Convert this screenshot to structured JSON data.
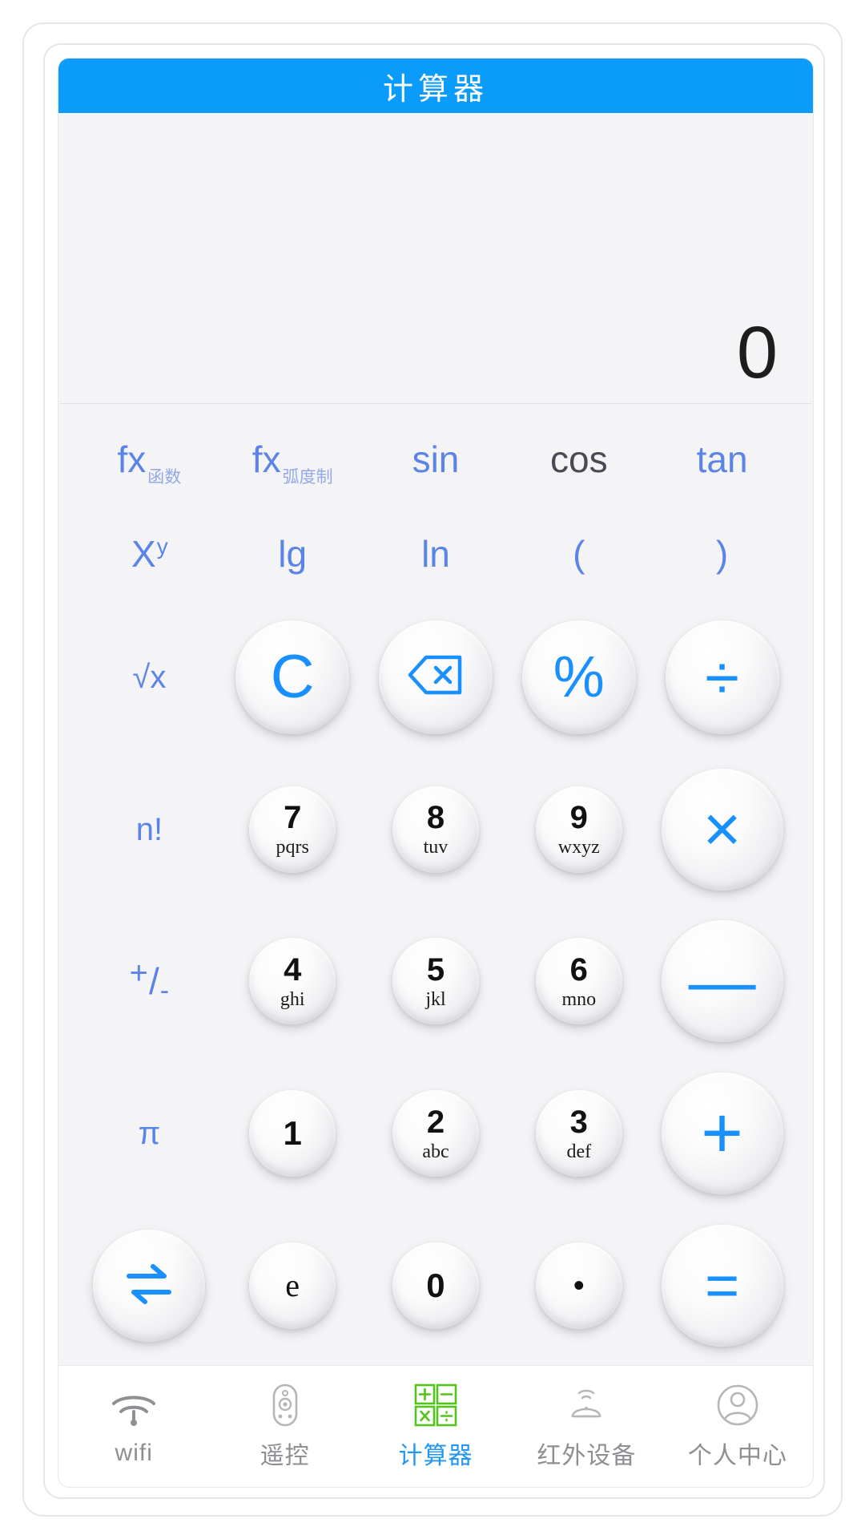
{
  "header": {
    "title": "计算器"
  },
  "display": {
    "expression": "",
    "value": "0"
  },
  "keypad": {
    "rows": [
      {
        "type": "text",
        "keys": [
          {
            "name": "key-function",
            "main": "fx",
            "sub": "函数",
            "style": "blue"
          },
          {
            "name": "key-radian",
            "main": "fx",
            "sub": "弧度制",
            "style": "blue"
          },
          {
            "name": "key-sin",
            "main": "sin",
            "sub": "",
            "style": "blue"
          },
          {
            "name": "key-cos",
            "main": "cos",
            "sub": "",
            "style": "dark"
          },
          {
            "name": "key-tan",
            "main": "tan",
            "sub": "",
            "style": "blue"
          }
        ]
      },
      {
        "type": "text",
        "keys": [
          {
            "name": "key-power",
            "main": "X",
            "sup": "y",
            "style": "blue"
          },
          {
            "name": "key-log10",
            "main": "lg",
            "style": "blue"
          },
          {
            "name": "key-ln",
            "main": "ln",
            "style": "blue"
          },
          {
            "name": "key-paren-open",
            "main": "(",
            "style": "blue"
          },
          {
            "name": "key-paren-close",
            "main": ")",
            "style": "blue"
          }
        ]
      }
    ],
    "flat_sqrt": "√x",
    "flat_factorial": "n!",
    "flat_plusminus": {
      "plus": "+",
      "slash": "/",
      "minus": "-"
    },
    "flat_pi": "π",
    "clear_label": "C",
    "backspace_label": "backspace",
    "percent_label": "%",
    "divide_label": "÷",
    "multiply_label": "×",
    "minus_label": "—",
    "plus_label": "+",
    "equals_label": "=",
    "swap_label": "swap",
    "e_label": "e",
    "zero_label": "0",
    "dot_label": "•",
    "numbers": [
      {
        "digit": "7",
        "letters": "pqrs"
      },
      {
        "digit": "8",
        "letters": "tuv"
      },
      {
        "digit": "9",
        "letters": "wxyz"
      },
      {
        "digit": "4",
        "letters": "ghi"
      },
      {
        "digit": "5",
        "letters": "jkl"
      },
      {
        "digit": "6",
        "letters": "mno"
      },
      {
        "digit": "1",
        "letters": ""
      },
      {
        "digit": "2",
        "letters": "abc"
      },
      {
        "digit": "3",
        "letters": "def"
      }
    ]
  },
  "nav": {
    "items": [
      {
        "label": "wifi",
        "icon": "wifi-icon",
        "active": false
      },
      {
        "label": "遥控",
        "icon": "remote-icon",
        "active": false
      },
      {
        "label": "计算器",
        "icon": "calculator-icon",
        "active": true
      },
      {
        "label": "红外设备",
        "icon": "infrared-icon",
        "active": false
      },
      {
        "label": "个人中心",
        "icon": "user-icon",
        "active": false
      }
    ]
  },
  "colors": {
    "header_blue": "#0b9cfb",
    "accent_blue": "#1890ff",
    "flat_key_blue": "#5b84e8",
    "active_nav_blue": "#2196f3",
    "calculator_icon_green": "#52c41a"
  }
}
